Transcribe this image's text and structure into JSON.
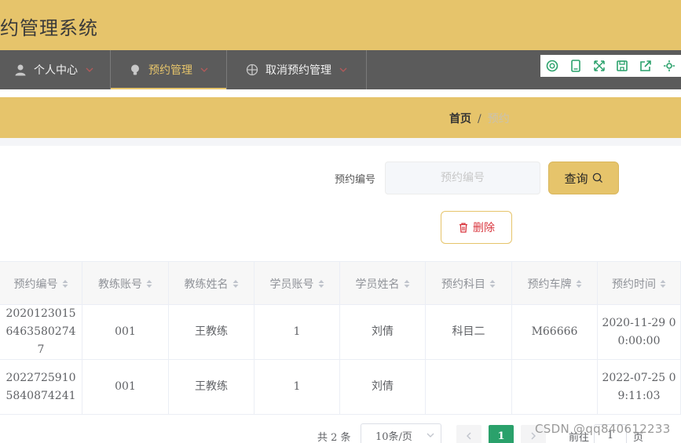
{
  "app": {
    "title": "约管理系统"
  },
  "nav": {
    "items": [
      {
        "label": "个人中心",
        "icon": "user-icon"
      },
      {
        "label": "预约管理",
        "icon": "bulb-icon",
        "active": true
      },
      {
        "label": "取消预约管理",
        "icon": "crosshair-icon"
      }
    ]
  },
  "toolbox": {
    "tools": [
      "search-tool-icon",
      "tablet-icon",
      "fullscreen-icon",
      "save-icon",
      "share-icon",
      "settings-icon"
    ]
  },
  "breadcrumb": {
    "home": "首页",
    "separator": "/",
    "current": "预约"
  },
  "search": {
    "label": "预约编号",
    "placeholder": "预约编号",
    "value": "",
    "button": "查询"
  },
  "actions": {
    "delete": "删除"
  },
  "table": {
    "columns": [
      "预约编号",
      "教练账号",
      "教练姓名",
      "学员账号",
      "学员姓名",
      "预约科目",
      "预约车牌",
      "预约时间"
    ],
    "rows": [
      [
        "202012301564635802747",
        "001",
        "王教练",
        "1",
        "刘倩",
        "科目二",
        "M66666",
        "2020-11-29 00:00:00"
      ],
      [
        "20227259105840874241",
        "001",
        "王教练",
        "1",
        "刘倩",
        "",
        "",
        "2022-07-25 09:11:03"
      ]
    ]
  },
  "pagination": {
    "total": "共 2 条",
    "page_size": "10条/页",
    "current": "1",
    "goto_prefix": "前往",
    "goto_value": "1",
    "goto_suffix": "页"
  },
  "watermark": "CSDN @qq840612233",
  "colors": {
    "primary": "#e6c46b",
    "nav": "#5b5b5b",
    "danger": "#d9363e",
    "page_active": "#2aa16b"
  }
}
